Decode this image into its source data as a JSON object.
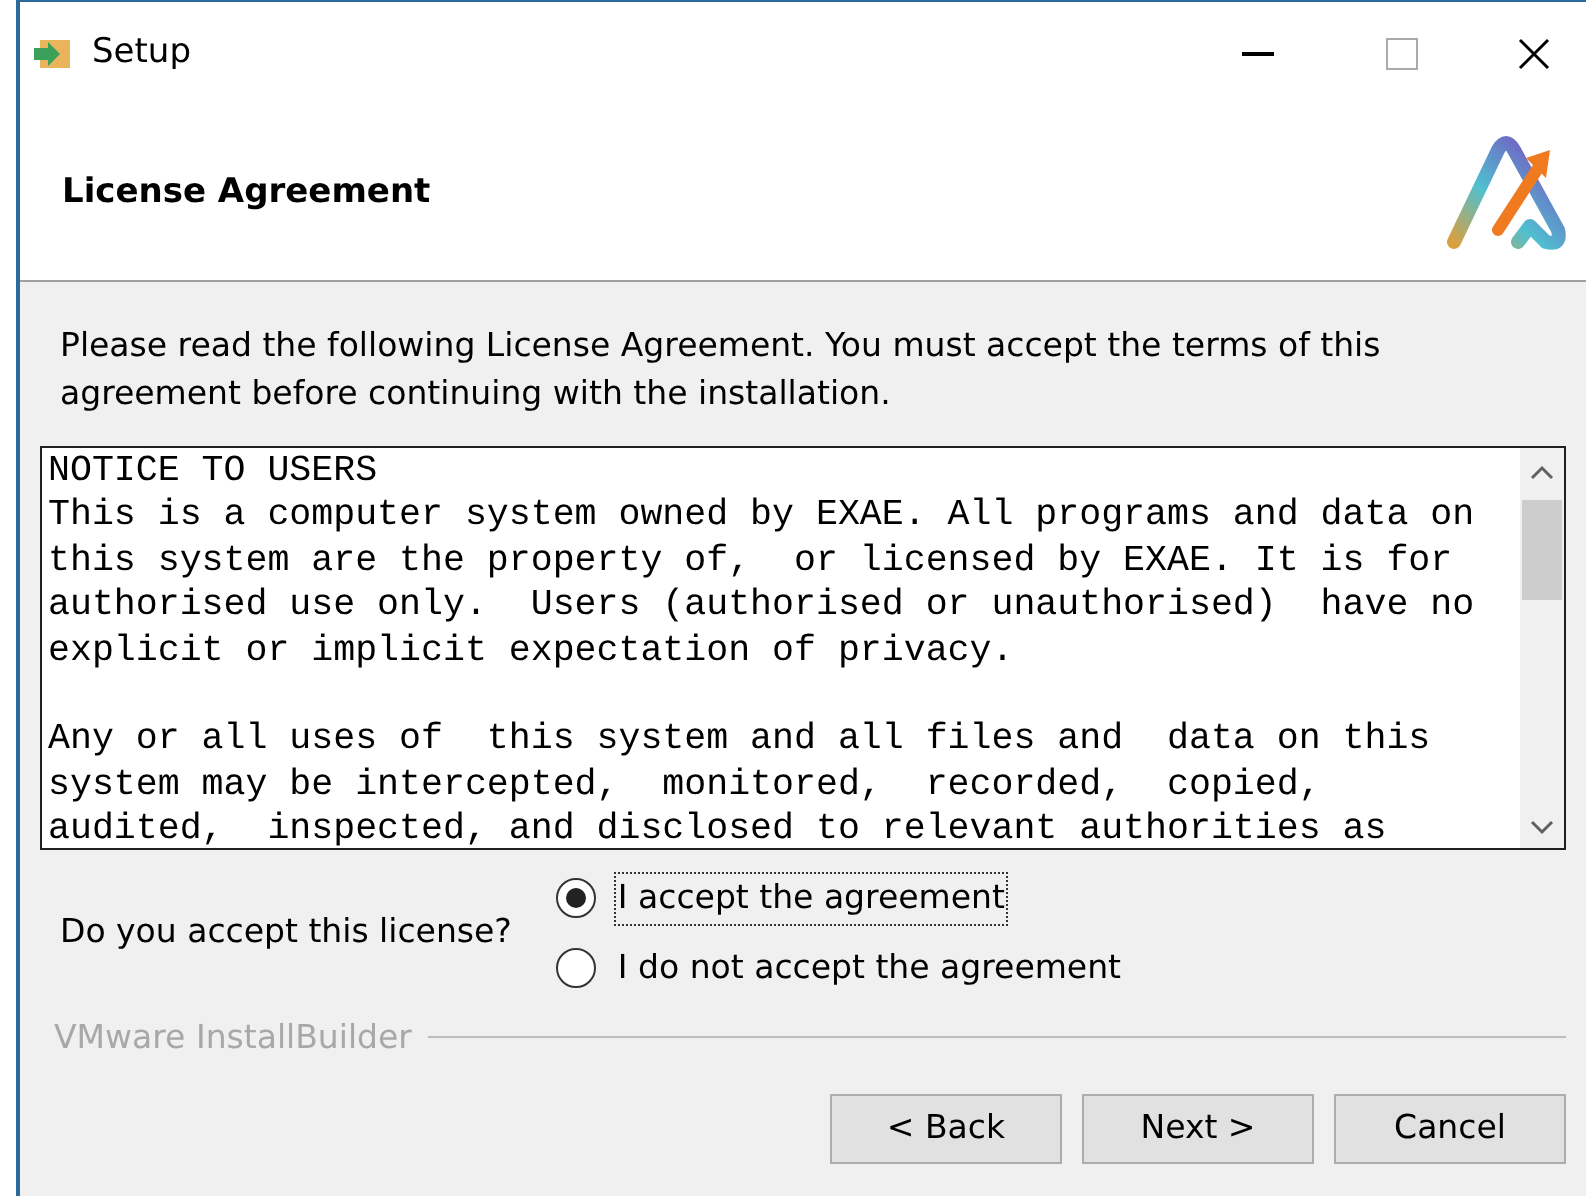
{
  "window": {
    "title": "Setup"
  },
  "header": {
    "title": "License Agreement"
  },
  "intro": "Please read the following License Agreement. You must accept the terms of this agreement before continuing with the installation.",
  "license_text": {
    "paragraphs": [
      {
        "lines": [
          "NOTICE TO USERS",
          "This is a computer system owned by EXAE. All programs and data on",
          "this system are the property of,  or licensed by EXAE. It is for",
          "authorised use only.  Users (authorised or unauthorised)  have no",
          "explicit or implicit expectation of privacy."
        ]
      },
      {
        "lines": [
          "Any or all uses of  this system and all files and  data on this",
          "system may be intercepted,  monitored,  recorded,  copied,",
          "audited,  inspected, and disclosed to relevant authorities as"
        ]
      }
    ]
  },
  "question": "Do you accept this license?",
  "options": [
    {
      "label": "I accept the agreement",
      "selected": true
    },
    {
      "label": "I do not accept the agreement",
      "selected": false
    }
  ],
  "footer_brand": "VMware InstallBuilder",
  "buttons": [
    "< Back",
    "Next >",
    "Cancel"
  ]
}
